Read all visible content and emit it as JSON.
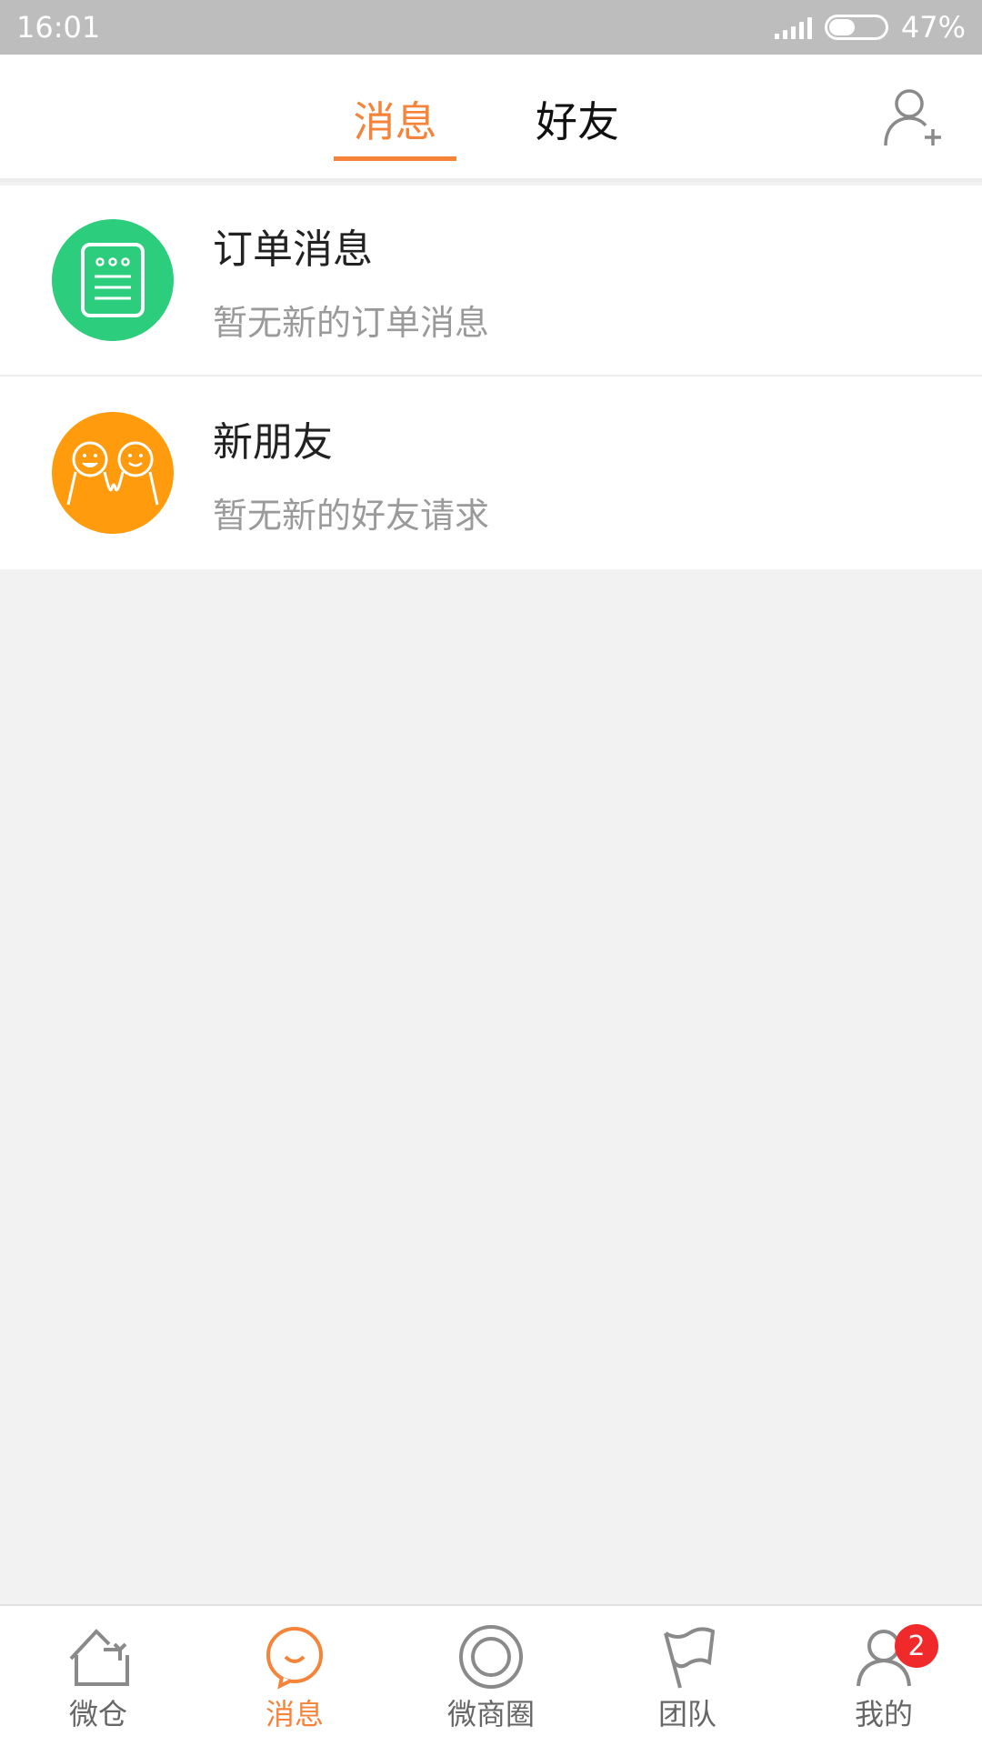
{
  "status_bar": {
    "time": "16:01",
    "battery_percent": "47%",
    "battery_level": 0.47
  },
  "header": {
    "tabs": [
      {
        "label": "消息",
        "active": true
      },
      {
        "label": "好友",
        "active": false
      }
    ],
    "add_friend_icon": "add-user-icon"
  },
  "messages": [
    {
      "title": "订单消息",
      "subtitle": "暂无新的订单消息",
      "icon": "order-list-icon",
      "color": "#2ccd7d"
    },
    {
      "title": "新朋友",
      "subtitle": "暂无新的好友请求",
      "icon": "friends-faces-icon",
      "color": "#ff9b0d"
    }
  ],
  "bottom_nav": {
    "items": [
      {
        "label": "微仓",
        "icon": "home-icon",
        "active": false
      },
      {
        "label": "消息",
        "icon": "chat-bubble-icon",
        "active": true
      },
      {
        "label": "微商圈",
        "icon": "circle-icon",
        "active": false
      },
      {
        "label": "团队",
        "icon": "flag-icon",
        "active": false
      },
      {
        "label": "我的",
        "icon": "user-icon",
        "active": false,
        "badge": "2"
      }
    ]
  },
  "colors": {
    "accent": "#f5843a",
    "badge": "#f02a2a",
    "background": "#f2f2f2"
  }
}
